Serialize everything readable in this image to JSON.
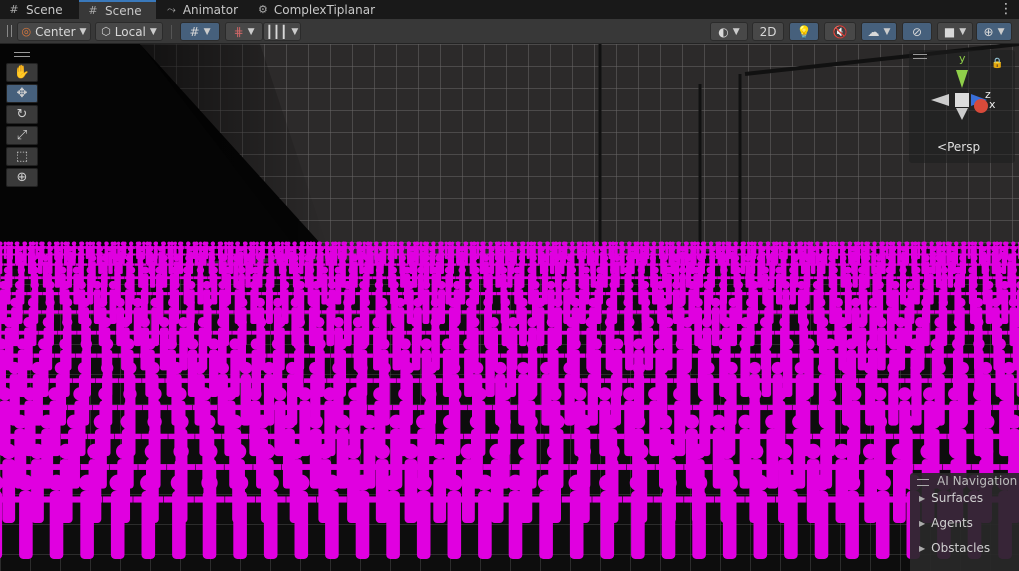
{
  "tabs": [
    {
      "label": "Scene",
      "icon": "grid-icon"
    },
    {
      "label": "Scene",
      "icon": "grid-icon"
    },
    {
      "label": "Animator",
      "icon": "animator-icon"
    },
    {
      "label": "ComplexTiplanar",
      "icon": "component-icon"
    }
  ],
  "toolbar": {
    "pivot_label": "Center",
    "space_label": "Local",
    "mode_2d_label": "2D"
  },
  "gizmo": {
    "y_label": "y",
    "z_label": "z",
    "x_label": "x",
    "projection_label": "Persp"
  },
  "ai_navigation": {
    "title": "AI Navigation",
    "items": [
      "Surfaces",
      "Agents",
      "Obstacles"
    ]
  },
  "colors": {
    "accent": "#3a79bb",
    "missing_material": "#e000e0"
  }
}
